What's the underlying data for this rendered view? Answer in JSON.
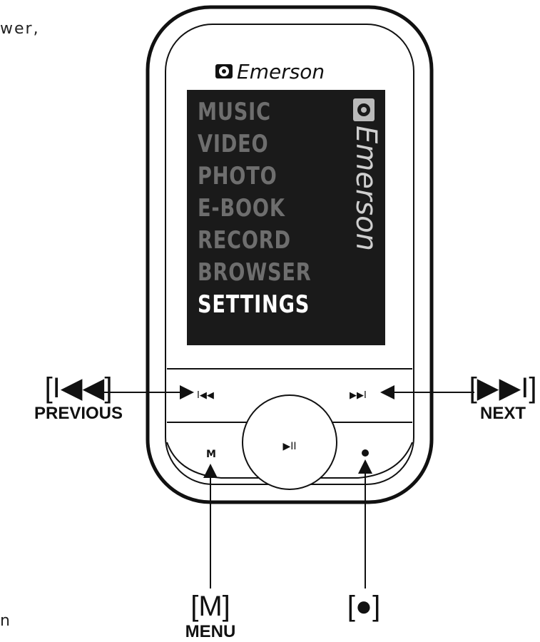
{
  "fragments": {
    "top": "wer,",
    "bottom": "n"
  },
  "device": {
    "brand": "Emerson",
    "side_brand": "Emerson",
    "menu_items": [
      {
        "label": "MUSIC",
        "selected": false
      },
      {
        "label": "VIDEO",
        "selected": false
      },
      {
        "label": "PHOTO",
        "selected": false
      },
      {
        "label": "E-BOOK",
        "selected": false
      },
      {
        "label": "RECORD",
        "selected": false
      },
      {
        "label": "BROWSER",
        "selected": false
      },
      {
        "label": "SETTINGS",
        "selected": true
      }
    ],
    "buttons": {
      "prev_glyph": "I◀◀",
      "next_glyph": "▶▶I",
      "play_glyph": "▶II",
      "menu_glyph": "M",
      "rec_glyph": "●"
    }
  },
  "callouts": {
    "previous": {
      "symbol": "[I◀◀]",
      "label": "PREVIOUS"
    },
    "next": {
      "symbol": "[▶▶I]",
      "label": "NEXT"
    },
    "menu": {
      "symbol": "[M]",
      "label": "MENU"
    },
    "record": {
      "symbol": "[●]"
    }
  },
  "colors": {
    "screen_bg": "#1a1a1a",
    "menu_inactive": "#6e6e6e",
    "menu_selected": "#ffffff",
    "outline": "#111111"
  }
}
